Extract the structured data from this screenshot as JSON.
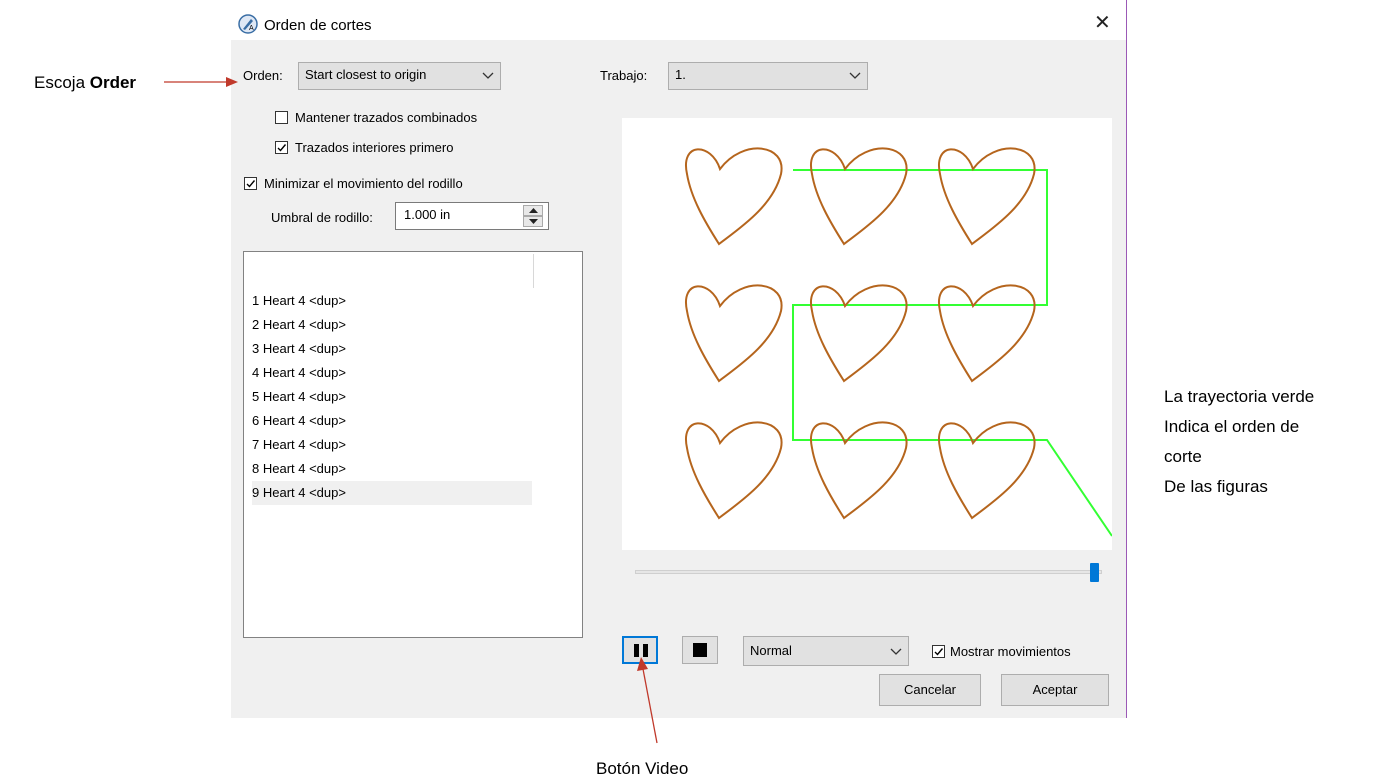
{
  "window": {
    "title": "Orden de cortes",
    "close_glyph": "✕"
  },
  "order": {
    "label": "Orden:",
    "value": "Start closest to origin"
  },
  "job": {
    "label": "Trabajo:",
    "value": "1."
  },
  "options": {
    "keep_compound": {
      "label": "Mantener trazados combinados",
      "checked": false
    },
    "inner_first": {
      "label": "Trazados interiores primero",
      "checked": true
    },
    "minimize_roller": {
      "label": "Minimizar el movimiento del rodillo",
      "checked": true
    }
  },
  "roller_threshold": {
    "label": "Umbral de rodillo:",
    "value": "1.000 in"
  },
  "shapes": [
    "1 Heart 4 <dup>",
    "2 Heart 4 <dup>",
    "3 Heart 4 <dup>",
    "4 Heart 4 <dup>",
    "5 Heart 4 <dup>",
    "6 Heart 4 <dup>",
    "7 Heart 4 <dup>",
    "8 Heart 4 <dup>",
    "9 Heart 4 <dup>"
  ],
  "selected_shape_index": 8,
  "playback": {
    "progress": 1.0,
    "speed": "Normal",
    "show_moves": {
      "label": "Mostrar movimientos",
      "checked": true
    }
  },
  "buttons": {
    "cancel": "Cancelar",
    "ok": "Aceptar"
  },
  "annotations": {
    "order_prefix": "Escoja ",
    "order_bold": "Order",
    "video": "Botón Video",
    "path_line1": "La trayectoria verde",
    "path_line2": "Indica el orden de",
    "path_line3": "corte",
    "path_line4": "De las figuras"
  },
  "colors": {
    "heart_stroke": "#b5651d",
    "path_stroke": "#33ff33",
    "arrow": "#c0392b",
    "accent": "#0078d7"
  },
  "icons": {
    "app": "cutter-app-icon",
    "checkmark": "checkmark-icon",
    "chevron": "chevron-down-icon",
    "pause": "pause-icon",
    "stop": "stop-icon"
  }
}
